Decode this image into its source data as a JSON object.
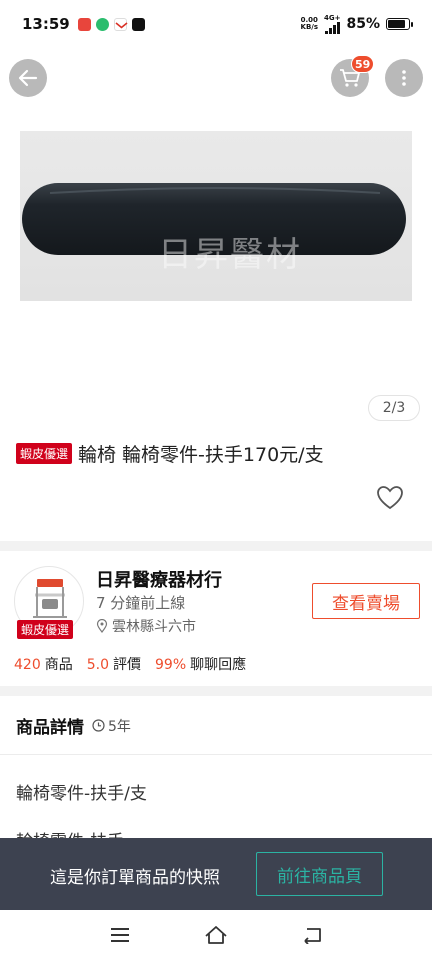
{
  "status_bar": {
    "time": "13:59",
    "net_speed_value": "0.00",
    "net_speed_unit": "KB/s",
    "network": "4G+",
    "battery": "85%",
    "battery_level": 0.85
  },
  "header": {
    "cart_count": "59"
  },
  "product": {
    "watermark": "日昇醫材",
    "image_counter": "2/3",
    "badge": "蝦皮優選",
    "title": "輪椅 輪椅零件-扶手170元/支"
  },
  "shop": {
    "name": "日昇醫療器材行",
    "online_status": "7 分鐘前上線",
    "location": "雲林縣斗六市",
    "avatar_badge": "蝦皮優選",
    "view_shop_label": "查看賣場",
    "stats": [
      {
        "value": "420",
        "label": "商品"
      },
      {
        "value": "5.0",
        "label": "評價"
      },
      {
        "value": "99%",
        "label": "聊聊回應"
      }
    ]
  },
  "details": {
    "title": "商品詳情",
    "age": "5年",
    "line1": "輪椅零件-扶手/支",
    "line2": "輪椅零件-扶手"
  },
  "snapshot": {
    "text": "這是你訂單商品的快照",
    "button": "前往商品頁"
  },
  "colors": {
    "accent": "#ee4d2d",
    "badge": "#d0011b",
    "banner": "#3d4250",
    "teal": "#2bb3a3"
  }
}
